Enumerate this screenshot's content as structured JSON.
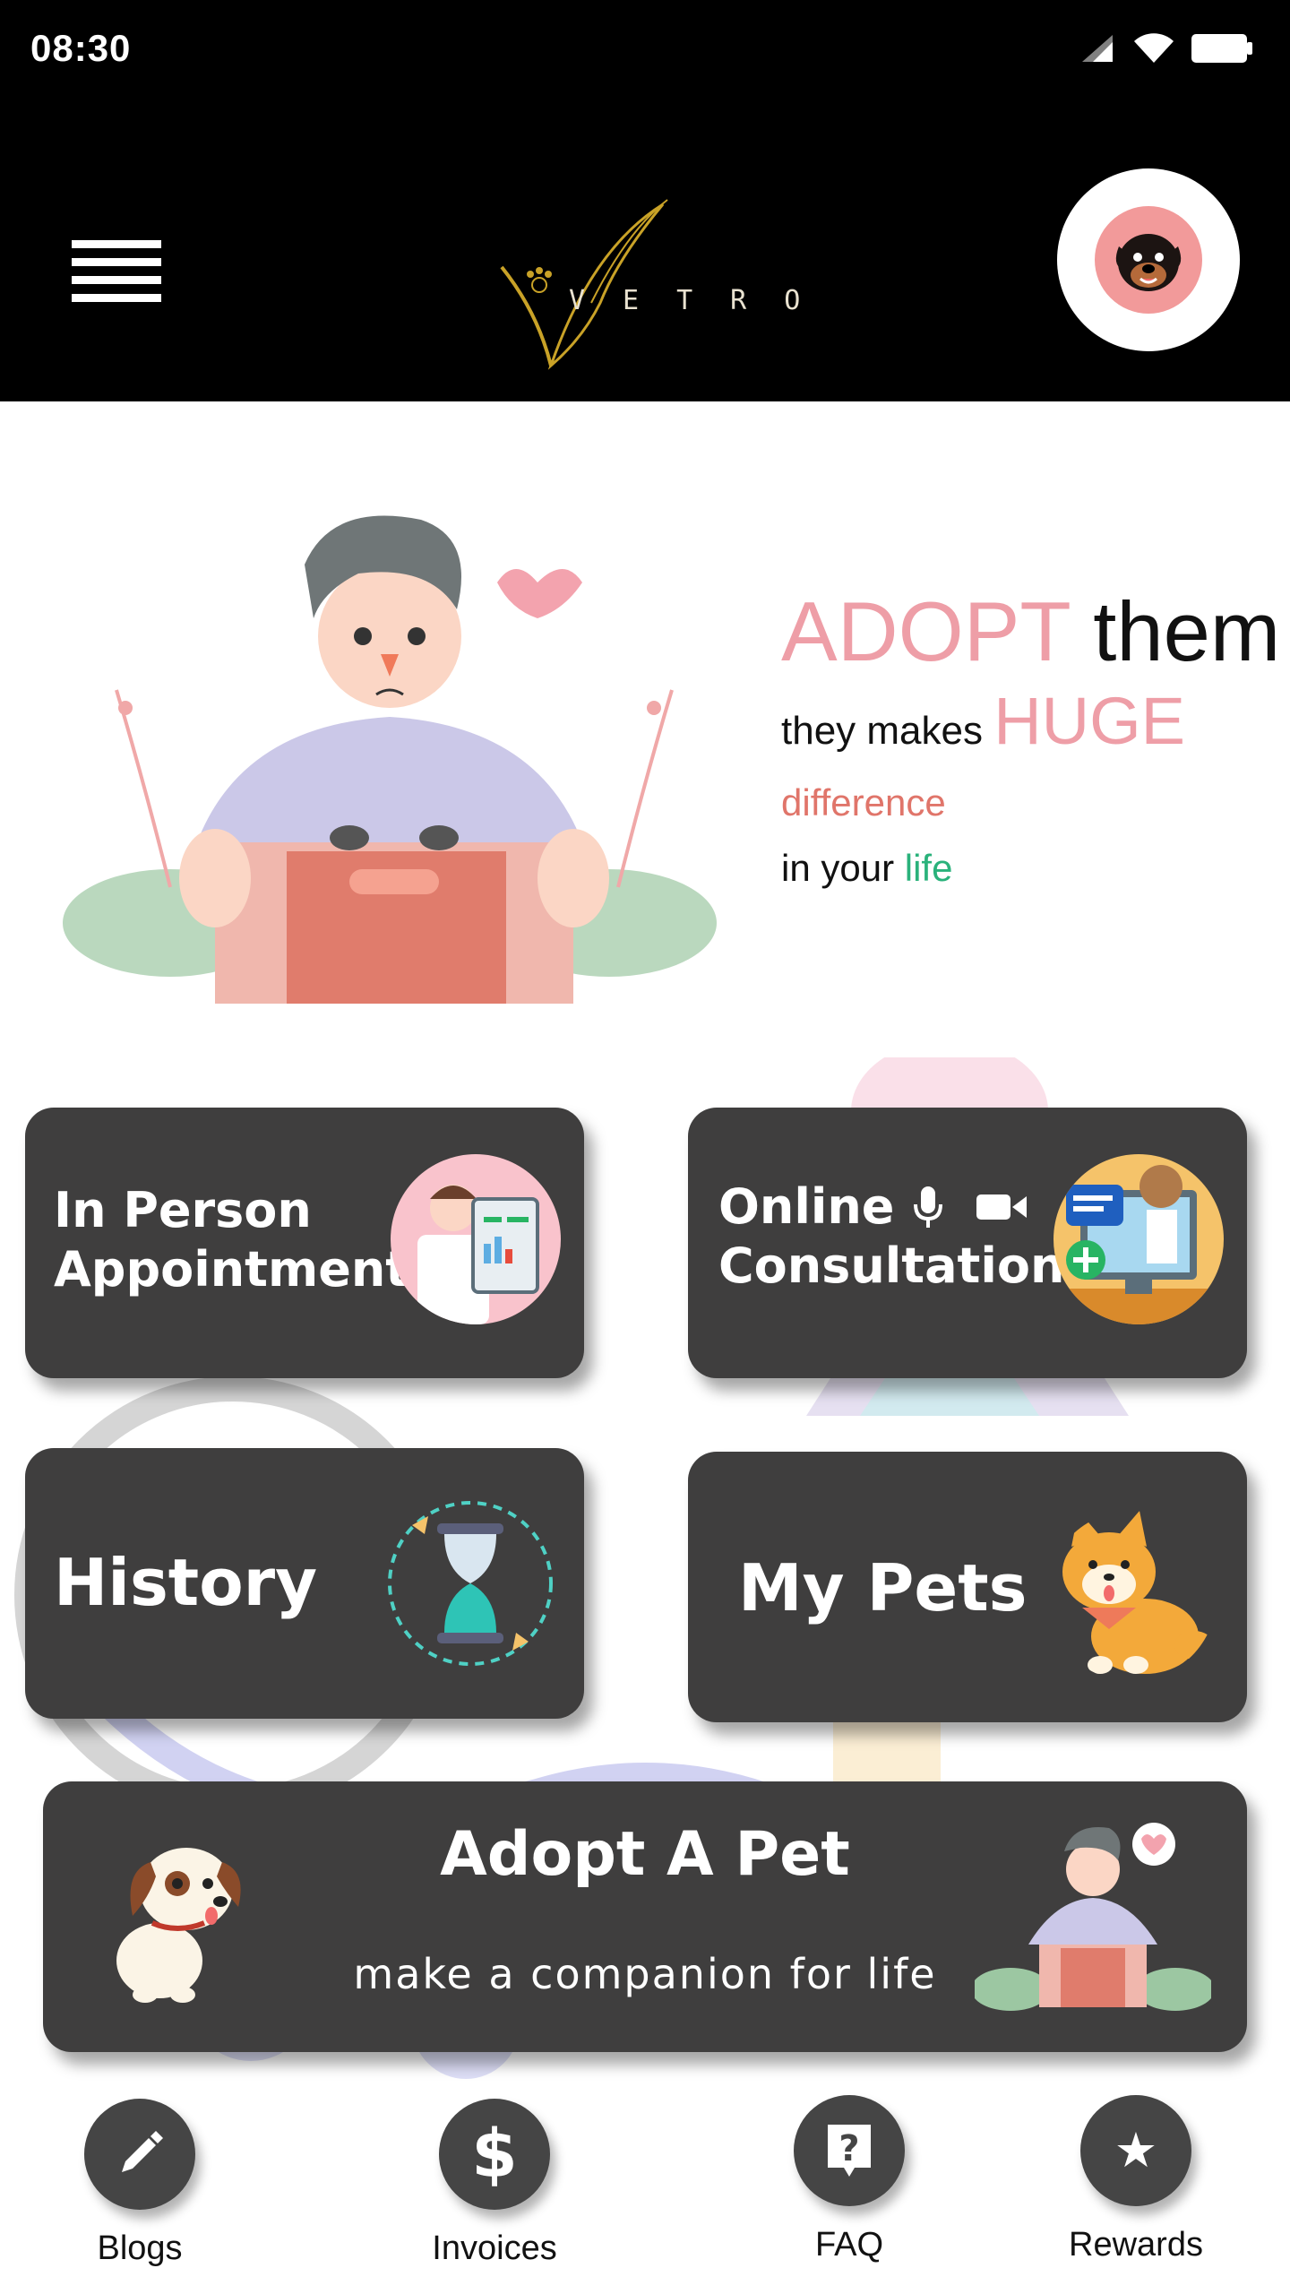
{
  "status_bar": {
    "time": "08:30"
  },
  "header": {
    "logo_text": "VETRO"
  },
  "hero": {
    "adopt": "ADOPT",
    "them": "them",
    "they_makes": "they makes",
    "huge": "HUGE",
    "difference": "difference",
    "in_your": "in your",
    "life": "life"
  },
  "cards": {
    "in_person": {
      "line1": "In Person",
      "line2": "Appointment"
    },
    "online": {
      "line1": "Online",
      "line2": "Consultation"
    },
    "history": {
      "label": "History"
    },
    "my_pets": {
      "label": "My Pets"
    },
    "adopt_pet": {
      "title": "Adopt A Pet",
      "subtitle": "make a companion for life"
    }
  },
  "bottom_nav": {
    "items": [
      {
        "label": "Blogs",
        "icon": "pencil-icon"
      },
      {
        "label": "Invoices",
        "icon": "dollar-icon"
      },
      {
        "label": "FAQ",
        "icon": "question-icon"
      },
      {
        "label": "Rewards",
        "icon": "star-icon"
      }
    ]
  },
  "colors": {
    "header_bg": "#000000",
    "card_bg": "#3f3e3e",
    "pink": "#ee9ea7",
    "coral": "#e0756a",
    "green": "#2ab27b"
  }
}
